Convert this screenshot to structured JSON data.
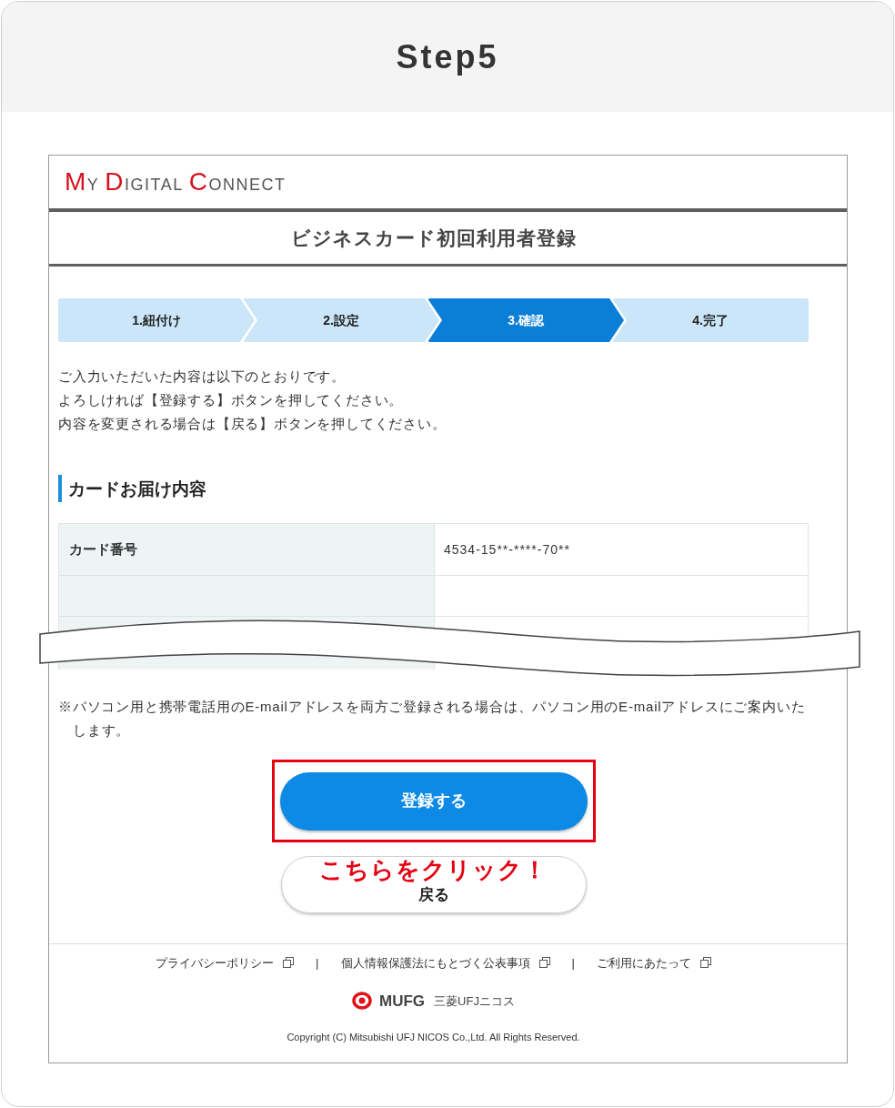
{
  "header": {
    "title": "Step5"
  },
  "site": {
    "logo": "MY DIGITAL CONNECT",
    "page_title": "ビジネスカード初回利用者登録"
  },
  "steps": [
    {
      "label": "1.紐付け",
      "selected": false
    },
    {
      "label": "2.設定",
      "selected": false
    },
    {
      "label": "3.確認",
      "selected": true
    },
    {
      "label": "4.完了",
      "selected": false
    }
  ],
  "intro_lines": [
    "ご入力いただいた内容は以下のとおりです。",
    "よろしければ【登録する】ボタンを押してください。",
    "内容を変更される場合は【戻る】ボタンを押してください。"
  ],
  "section": {
    "heading": "カードお届け内容"
  },
  "table": {
    "rows": [
      {
        "label": "カード番号",
        "value": "4534-15**-****-70**"
      }
    ]
  },
  "note": "※パソコン用と携帯電話用のE-mailアドレスを両方ご登録される場合は、パソコン用のE-mailアドレスにご案内いたします。",
  "buttons": [
    {
      "label": "登録する",
      "kind": "primary",
      "highlighted": true
    },
    {
      "label": "戻る",
      "kind": "secondary",
      "highlighted": false
    }
  ],
  "callout": {
    "text": "こちらをクリック！"
  },
  "footer": {
    "links": [
      "プライバシーポリシー",
      "個人情報保護法にもとづく公表事項",
      "ご利用にあたって"
    ],
    "separators": [
      "|",
      "|"
    ],
    "brand": "MUFG",
    "brand_sub": "三菱UFJニコス",
    "copyright": "Copyright (C) Mitsubishi UFJ NICOS Co.,Ltd. All Rights Reserved."
  }
}
